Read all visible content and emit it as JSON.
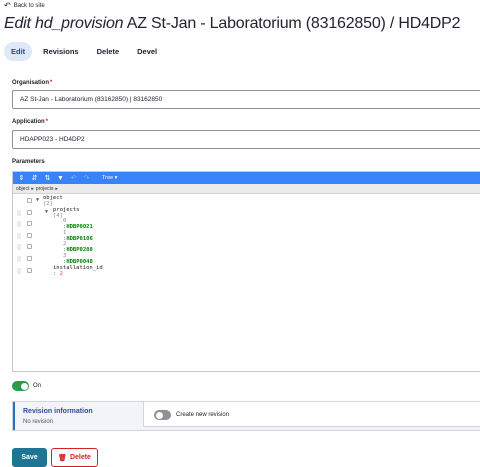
{
  "back_link": {
    "label": "Back to site"
  },
  "title": {
    "prefix": "Edit",
    "entity": "hd_provision",
    "rest": "AZ St-Jan - Laboratorium (83162850) / HD4DP2"
  },
  "tabs": [
    {
      "label": "Edit",
      "active": true
    },
    {
      "label": "Revisions"
    },
    {
      "label": "Delete"
    },
    {
      "label": "Devel"
    }
  ],
  "organisation": {
    "label": "Organisation",
    "required": "*",
    "value": "AZ St-Jan - Laboratorium (83162850) | 83162850"
  },
  "application": {
    "label": "Application",
    "required": "*",
    "value": "HDAPP023 - HD4DP2"
  },
  "parameters": {
    "label": "Parameters",
    "mode": "Tree ▾",
    "breadcrumb": [
      "object",
      "projects"
    ],
    "tree": {
      "root_key": "object",
      "root_count": "{2}",
      "projects_key": "projects",
      "projects_count": "[4]",
      "items": [
        {
          "index": "0",
          "value": "HDBP0021"
        },
        {
          "index": "1",
          "value": "HDBP0106"
        },
        {
          "index": "2",
          "value": "HDBP0208"
        },
        {
          "index": "3",
          "value": "HDBP0048"
        }
      ],
      "installation_key": "installation_id",
      "installation_value": "2"
    }
  },
  "published": {
    "label": "On",
    "state": "on"
  },
  "revision": {
    "title": "Revision information",
    "subtitle": "No revision",
    "checkbox_label": "Create new revision"
  },
  "actions": {
    "save": "Save",
    "delete": "Delete"
  },
  "colors": {
    "accent": "#1f7594",
    "danger": "#d72222",
    "editor_menu": "#3883fa",
    "toggle_on": "#2b9c4a"
  }
}
